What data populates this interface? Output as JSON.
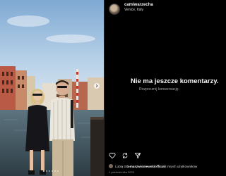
{
  "post": {
    "username": "camiwarzecha",
    "location": "Venice, Italy"
  },
  "comments": {
    "empty_title": "Nie ma jeszcze komentarzy.",
    "empty_subtitle": "Rozpocznij konwersację."
  },
  "likes": {
    "prefix": "Lubią to ",
    "user": "tomaszwisniewskiofficial",
    "suffix": " i innych użytkowników"
  },
  "date": "1 października 2025",
  "icons": {
    "like": "heart-icon",
    "repost": "repost-icon",
    "share": "send-icon"
  },
  "colors": {
    "background": "#000000",
    "text": "#f5f5f5",
    "muted": "#a8a8a8"
  }
}
